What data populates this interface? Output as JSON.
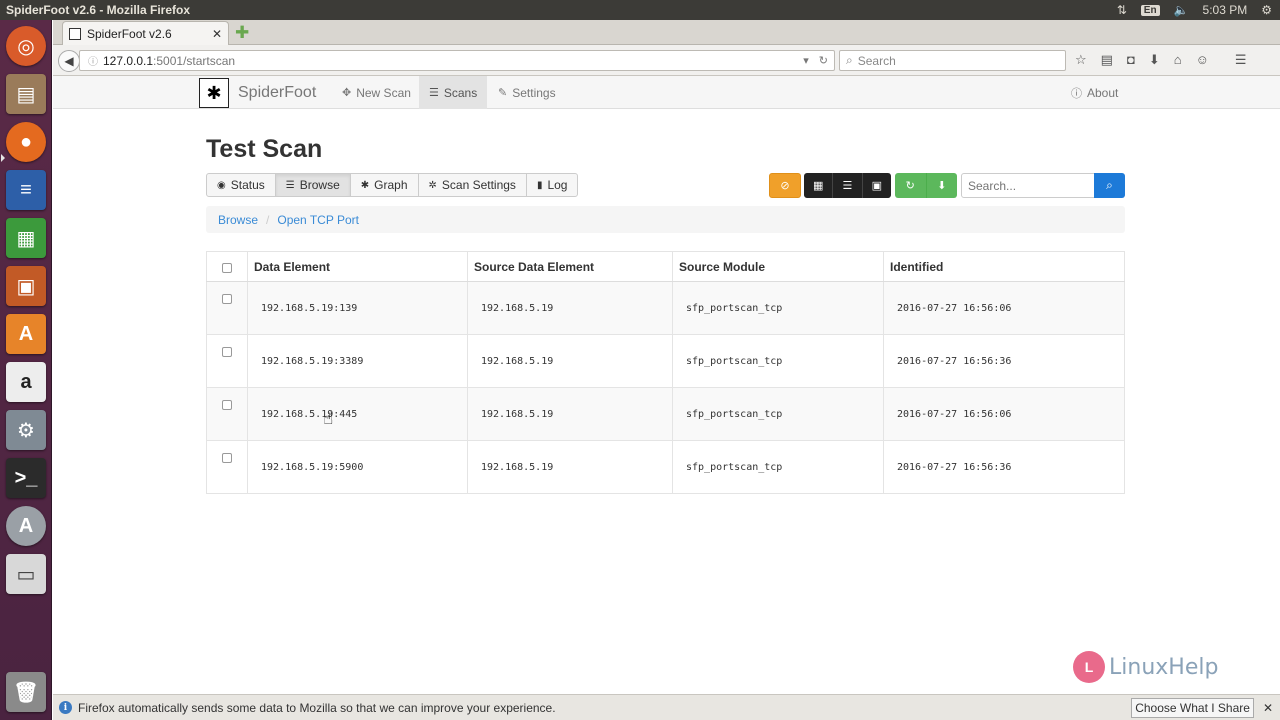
{
  "os": {
    "window_title": "SpiderFoot v2.6 - Mozilla Firefox",
    "keyboard_layout": "En",
    "clock": "5:03 PM"
  },
  "launcher": {
    "items": [
      "ubuntu-dash",
      "files",
      "firefox",
      "writer",
      "calc",
      "impress",
      "software-center",
      "amazon",
      "system-settings",
      "terminal",
      "software-updater",
      "disks",
      "trash"
    ]
  },
  "browser": {
    "tab_title": "SpiderFoot v2.6",
    "url_host": "127.0.0.1",
    "url_path": ":5001/startscan",
    "search_placeholder": "Search"
  },
  "spiderfoot": {
    "brand": "SpiderFoot",
    "nav": {
      "new_scan": "New Scan",
      "scans": "Scans",
      "settings": "Settings",
      "about": "About"
    },
    "page_title": "Test Scan",
    "tabs": {
      "status": "Status",
      "browse": "Browse",
      "graph": "Graph",
      "scan_settings": "Scan Settings",
      "log": "Log"
    },
    "search_placeholder": "Search...",
    "breadcrumb": {
      "root": "Browse",
      "current": "Open TCP Port"
    },
    "table": {
      "headers": {
        "data_element": "Data Element",
        "source_data_element": "Source Data Element",
        "source_module": "Source Module",
        "identified": "Identified"
      },
      "rows": [
        {
          "data_element": "192.168.5.19:139",
          "source": "192.168.5.19",
          "module": "sfp_portscan_tcp",
          "identified": "2016-07-27 16:56:06"
        },
        {
          "data_element": "192.168.5.19:3389",
          "source": "192.168.5.19",
          "module": "sfp_portscan_tcp",
          "identified": "2016-07-27 16:56:36"
        },
        {
          "data_element": "192.168.5.19:445",
          "source": "192.168.5.19",
          "module": "sfp_portscan_tcp",
          "identified": "2016-07-27 16:56:06"
        },
        {
          "data_element": "192.168.5.19:5900",
          "source": "192.168.5.19",
          "module": "sfp_portscan_tcp",
          "identified": "2016-07-27 16:56:36"
        }
      ]
    }
  },
  "watermark": {
    "text": "LinuxHelp"
  },
  "notification": {
    "message": "Firefox automatically sends some data to Mozilla so that we can improve your experience.",
    "button": "Choose What I Share"
  }
}
